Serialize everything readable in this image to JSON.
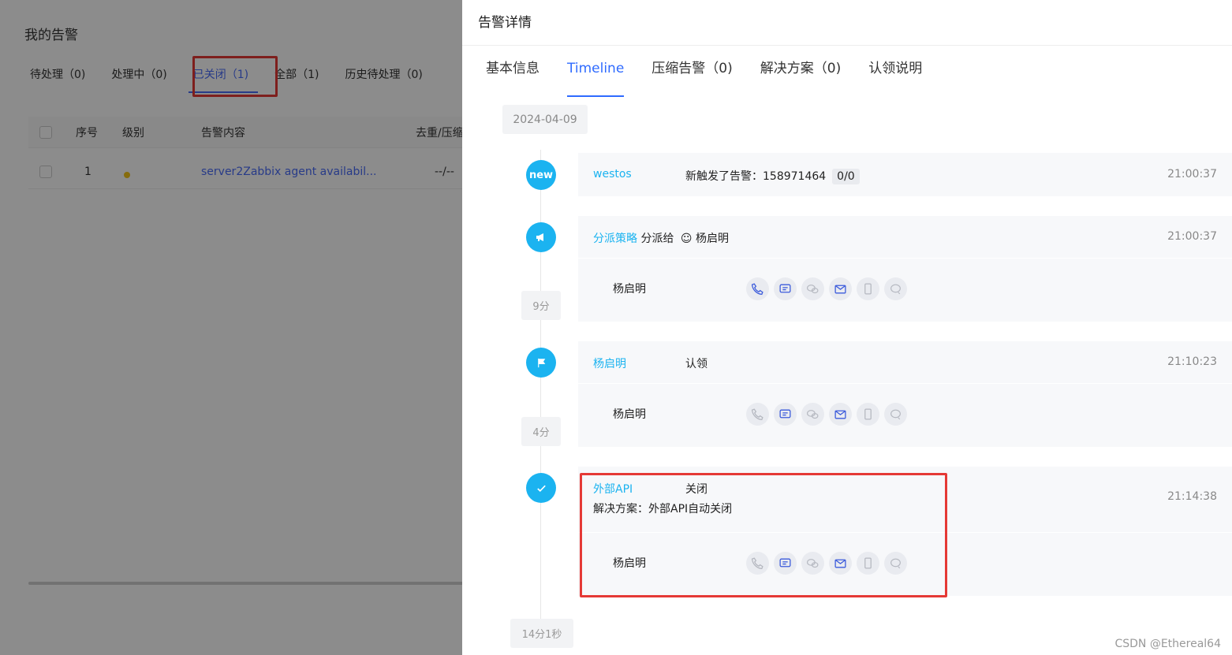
{
  "left": {
    "title": "我的告警",
    "tabs": [
      {
        "label": "待处理（0)"
      },
      {
        "label": "处理中（0)"
      },
      {
        "label": "已关闭（1)"
      },
      {
        "label": "全部（1)"
      },
      {
        "label": "历史待处理（0)"
      }
    ],
    "table": {
      "headers": [
        "序号",
        "级别",
        "告警内容",
        "去重/压缩"
      ],
      "rows": [
        {
          "index": "1",
          "content": "server2Zabbix agent availabil...",
          "dedup": "--/--"
        }
      ]
    }
  },
  "drawer": {
    "title": "告警详情",
    "tabs": [
      {
        "label": "基本信息"
      },
      {
        "label": "Timeline"
      },
      {
        "label": "压缩告警（0)"
      },
      {
        "label": "解决方案（0)"
      },
      {
        "label": "认领说明"
      }
    ],
    "date": "2024-04-09",
    "events": [
      {
        "node_label": "new",
        "actor": "westos",
        "action": "新触发了告警：158971464",
        "badge": "0/0",
        "time": "21:00:37"
      },
      {
        "actor": "分派策略",
        "action": "分派给",
        "assignee": "杨启明",
        "time": "21:00:37",
        "person": "杨启明",
        "duration": "9分"
      },
      {
        "actor": "杨启明",
        "action": "认领",
        "time": "21:10:23",
        "person": "杨启明",
        "duration": "4分"
      },
      {
        "actor": "外部API",
        "action": "关闭",
        "resolution": "解决方案：外部API自动关闭",
        "time": "21:14:38",
        "person": "杨启明",
        "duration": "14分1秒"
      }
    ],
    "notify_icons": [
      "phone-icon",
      "sms-icon",
      "wechat-icon",
      "email-icon",
      "app-icon",
      "bot-icon"
    ],
    "colors": {
      "accent": "#1bb3f0",
      "active_tab": "#2f6bff",
      "annotation": "#e53935"
    }
  },
  "watermark": "CSDN @Ethereal64"
}
